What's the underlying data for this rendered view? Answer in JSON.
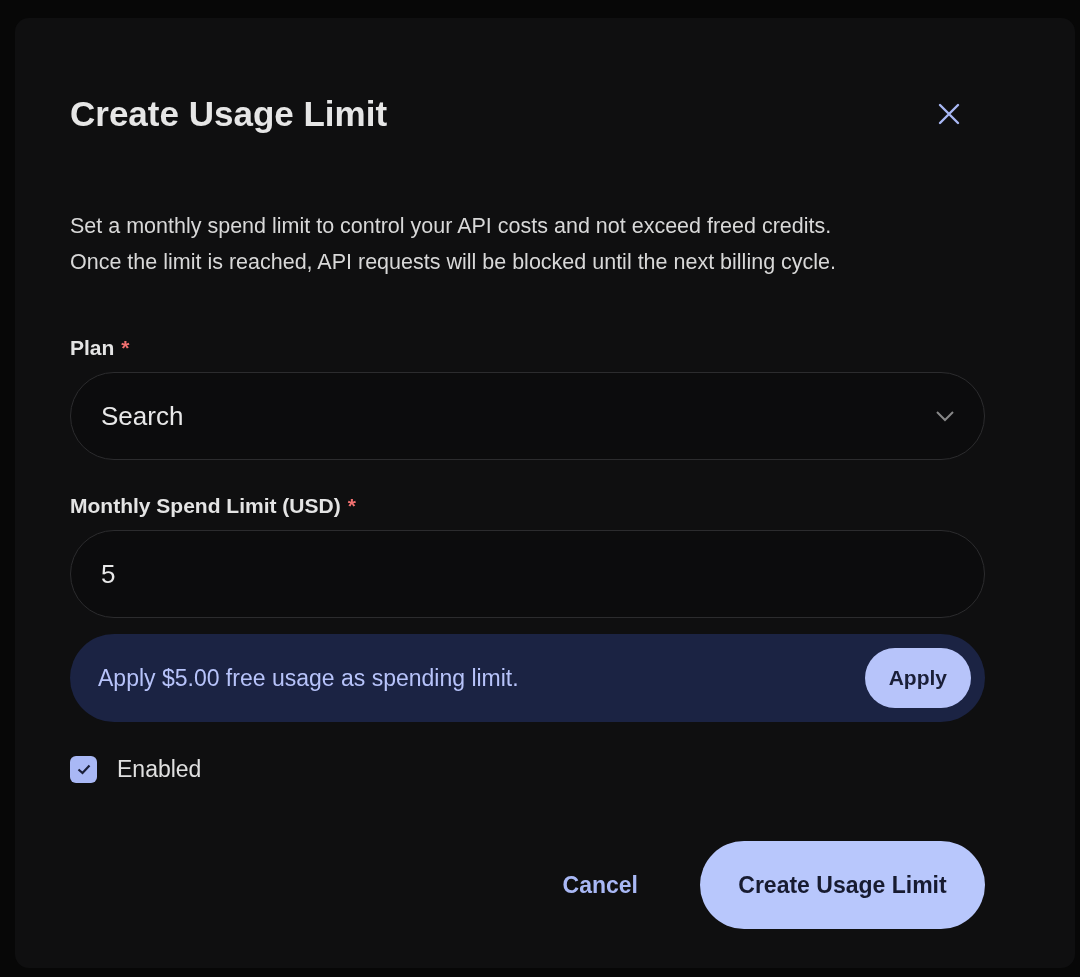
{
  "dialog": {
    "title": "Create Usage Limit",
    "description": "Set a monthly spend limit to control your API costs and not exceed freed credits. Once the limit is reached, API requests will be blocked until the next billing cycle.",
    "fields": [
      {
        "kind": "select",
        "label": "Plan",
        "required_mark": "*",
        "value": "Search"
      },
      {
        "kind": "input",
        "label": "Monthly Spend Limit (USD)",
        "required_mark": "*",
        "value": "5"
      }
    ],
    "banner": {
      "text": "Apply $5.00 free usage as spending limit.",
      "button": "Apply"
    },
    "enabled": {
      "label": "Enabled",
      "checked": true
    },
    "buttons": {
      "cancel": "Cancel",
      "submit": "Create Usage Limit"
    }
  }
}
